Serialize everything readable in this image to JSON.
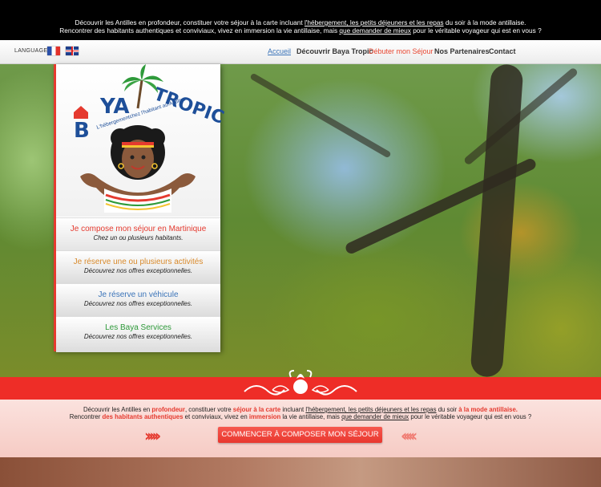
{
  "top_banner": {
    "line1_a": "Découvrir les Antilles en profondeur, constituer votre séjour à la carte incluant ",
    "line1_link": "l'hébergement, les petits déjeuners et les repas",
    "line1_b": " du soir à la mode antillaise.",
    "line2_a": "Rencontrer des habitants authentiques et conviviaux, vivez en immersion la vie antillaise, mais ",
    "line2_link": "que demander de mieux",
    "line2_b": " pour le véritable voyageur qui est en vous ?"
  },
  "navbar": {
    "language_label": "LANGUAGE :",
    "flags": [
      "french-flag-icon",
      "uk-flag-icon"
    ],
    "links": [
      "Accueil",
      "Découvrir Baya Tropic",
      "Débuter mon Séjour",
      "Nos Partenaires",
      "Contact"
    ]
  },
  "logo": {
    "text_a": "B",
    "text_b": "YA",
    "text_c": "TROPIC",
    "tagline": "L'hébergementchez l'habitant au Antilles"
  },
  "side_menu": [
    {
      "title": "Je compose mon séjour en Martinique",
      "subtitle": "Chez un ou plusieurs habitants."
    },
    {
      "title": "Je réserve une ou plusieurs activités",
      "subtitle": "Découvrez nos offres exceptionnelles."
    },
    {
      "title": "Je réserve un véhicule",
      "subtitle": "Découvrez nos offres exceptionnelles."
    },
    {
      "title": "Les Baya Services",
      "subtitle": "Découvrez nos offres exceptionnelles."
    }
  ],
  "promo": {
    "p1_a": "Découvrir les Antilles en ",
    "p1_hl1": "profondeur",
    "p1_b": ", constituer votre ",
    "p1_hl2": "séjour à la carte",
    "p1_c": " incluant ",
    "p1_link": "l'hébergement, les petits déjeuners et les repas",
    "p1_d": " du soir ",
    "p1_hl3": "à la mode antillaise.",
    "p2_a": "Rencontrer ",
    "p2_hl1": "des habitants authentiques",
    "p2_b": " et conviviaux, vivez en ",
    "p2_hl2": "immersion",
    "p2_c": " la vie antillaise, mais ",
    "p2_link": "que demander de mieux",
    "p2_d": " pour le véritable voyageur qui est en vous ?",
    "cta": "COMMENCER À COMPOSER MON SÉJOUR",
    "chevrons_left": "›››››",
    "chevrons_right": "‹‹‹‹‹"
  },
  "colors": {
    "accent_red": "#ee2d27",
    "nav_blue": "#3a73b8",
    "logo_blue": "#1e4f99"
  }
}
